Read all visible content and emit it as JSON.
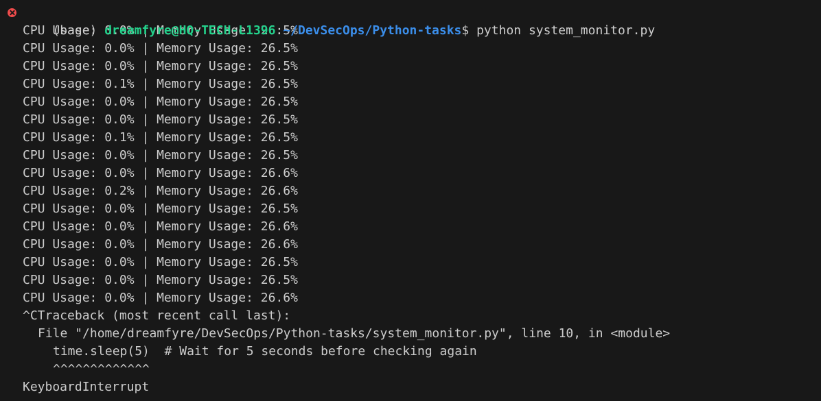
{
  "prompt": {
    "env": "(base) ",
    "user_host": "dreamfyre@HQ-TECH-L1396",
    "colon": ":",
    "path": "~/DevSecOps/Python-tasks",
    "dollar": "$ ",
    "command": "python system_monitor.py"
  },
  "output_lines": [
    "CPU Usage: 0.0% | Memory Usage: 26.5%",
    "CPU Usage: 0.0% | Memory Usage: 26.5%",
    "CPU Usage: 0.0% | Memory Usage: 26.5%",
    "CPU Usage: 0.1% | Memory Usage: 26.5%",
    "CPU Usage: 0.0% | Memory Usage: 26.5%",
    "CPU Usage: 0.0% | Memory Usage: 26.5%",
    "CPU Usage: 0.1% | Memory Usage: 26.5%",
    "CPU Usage: 0.0% | Memory Usage: 26.5%",
    "CPU Usage: 0.0% | Memory Usage: 26.6%",
    "CPU Usage: 0.2% | Memory Usage: 26.6%",
    "CPU Usage: 0.0% | Memory Usage: 26.5%",
    "CPU Usage: 0.0% | Memory Usage: 26.6%",
    "CPU Usage: 0.0% | Memory Usage: 26.6%",
    "CPU Usage: 0.0% | Memory Usage: 26.5%",
    "CPU Usage: 0.0% | Memory Usage: 26.5%",
    "CPU Usage: 0.0% | Memory Usage: 26.6%"
  ],
  "traceback": {
    "header": "^CTraceback (most recent call last):",
    "file_line": "File \"/home/dreamfyre/DevSecOps/Python-tasks/system_monitor.py\", line 10, in <module>",
    "code_line": "time.sleep(5)  # Wait for 5 seconds before checking again",
    "marker_line": "^^^^^^^^^^^^^",
    "error": "KeyboardInterrupt"
  },
  "colors": {
    "background": "#181818",
    "text": "#cccccc",
    "user_host": "#23d18b",
    "path": "#3b8eea",
    "error_icon": "#f14c4c"
  },
  "icons": {
    "status": "error-circle-x-icon"
  }
}
